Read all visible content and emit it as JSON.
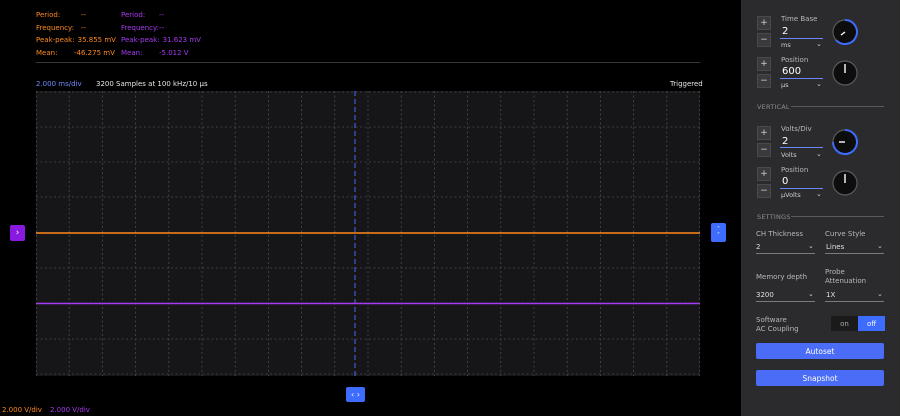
{
  "measurements": {
    "ch1": {
      "period_label": "Period:",
      "period_value": "--",
      "frequency_label": "Frequency:",
      "frequency_value": "--",
      "peak_label": "Peak-peak:",
      "peak_value": "35.855 mV",
      "mean_label": "Mean:",
      "mean_value": "-46.275 mV"
    },
    "ch2": {
      "period_label": "Period:",
      "period_value": "--",
      "frequency_label": "Frequency:",
      "frequency_value": "--",
      "peak_label": "Peak-peak:",
      "peak_value": "31.623 mV",
      "mean_label": "Mean:",
      "mean_value": "-5.012 V"
    }
  },
  "scope": {
    "timediv": "2.000 ms/div",
    "samples": "3200 Samples at 100 kHz/10 µs",
    "status": "Triggered",
    "ch1_scale": "2.000 V/div",
    "ch2_scale": "2.000 V/div"
  },
  "horizontal": {
    "timebase_label": "Time Base",
    "timebase_value": "2",
    "timebase_unit": "ms",
    "position_label": "Position",
    "position_value": "600",
    "position_unit": "µs"
  },
  "vertical": {
    "section": "VERTICAL",
    "voltsdiv_label": "Volts/Div",
    "voltsdiv_value": "2",
    "voltsdiv_unit": "Volts",
    "position_label": "Position",
    "position_value": "0",
    "position_unit": "µVolts"
  },
  "settings": {
    "section": "SETTINGS",
    "thickness_label": "CH Thickness",
    "thickness_value": "2",
    "curve_label": "Curve Style",
    "curve_value": "Lines",
    "memory_label": "Memory depth",
    "memory_value": "3200",
    "probe_label_1": "Probe",
    "probe_label_2": "Attenuation",
    "probe_value": "1X",
    "coupling_label_1": "Software",
    "coupling_label_2": "AC Coupling",
    "toggle_on": "on",
    "toggle_off": "off",
    "autoset": "Autoset",
    "snapshot": "Snapshot"
  },
  "colors": {
    "ch1": "#ff8a1e",
    "ch2": "#a63af2",
    "accent": "#3d6cff",
    "panel": "#2b2b2d"
  }
}
